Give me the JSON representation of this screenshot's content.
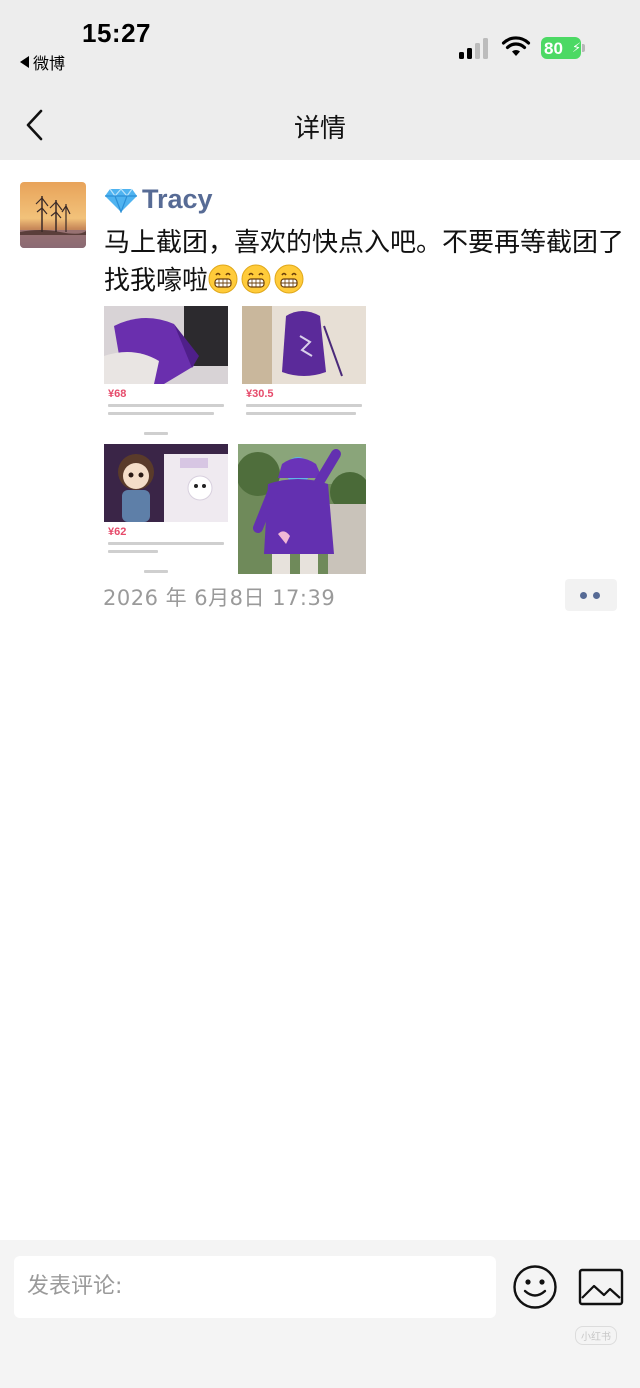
{
  "status_bar": {
    "time": "15:27",
    "back_app": "微博",
    "battery": "80"
  },
  "nav": {
    "title": "详情"
  },
  "post": {
    "author": "Tracy",
    "author_icon": "gem-icon",
    "text": "马上截团，喜欢的快点入吧。不要再等截团了找我嚎啦",
    "emoji": [
      "grimacing-face",
      "grimacing-face",
      "grimacing-face"
    ],
    "images": [
      {
        "price": "¥68"
      },
      {
        "price": "¥30.5"
      },
      {
        "price": "¥62"
      },
      {
        "price": ""
      }
    ],
    "timestamp": "2026 年 6月8日 17:39"
  },
  "comment_bar": {
    "placeholder": "发表评论:"
  },
  "colors": {
    "accent_link": "#576b95",
    "background_top": "#ededed",
    "price": "#e64b6b",
    "battery": "#4cd964"
  }
}
